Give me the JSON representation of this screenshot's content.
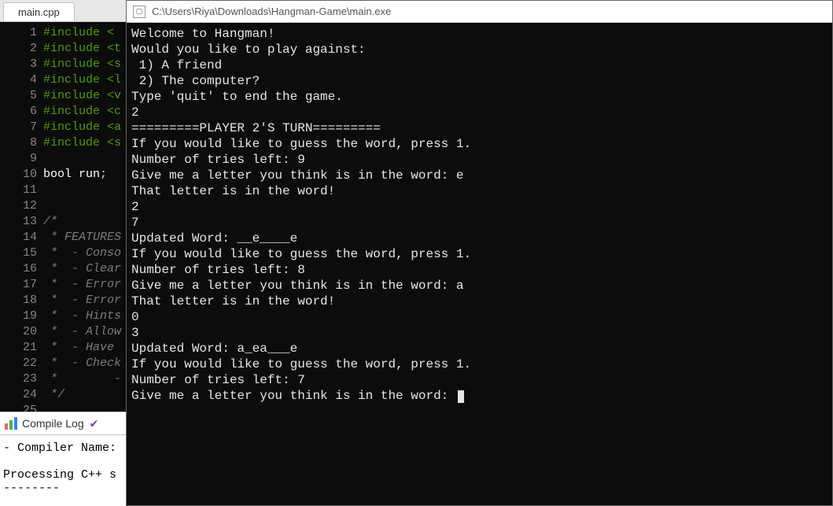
{
  "editor": {
    "tab_label": "main.cpp",
    "lines": [
      {
        "n": "1",
        "cls": "kw-include",
        "t": "#include <"
      },
      {
        "n": "2",
        "cls": "kw-include",
        "t": "#include <t"
      },
      {
        "n": "3",
        "cls": "kw-include",
        "t": "#include <s"
      },
      {
        "n": "4",
        "cls": "kw-include",
        "t": "#include <l"
      },
      {
        "n": "5",
        "cls": "kw-include",
        "t": "#include <v"
      },
      {
        "n": "6",
        "cls": "kw-include",
        "t": "#include <c"
      },
      {
        "n": "7",
        "cls": "kw-include",
        "t": "#include <a"
      },
      {
        "n": "8",
        "cls": "kw-include",
        "t": "#include <s"
      },
      {
        "n": "9",
        "cls": "",
        "t": ""
      },
      {
        "n": "10",
        "cls": "",
        "t": "bool run;"
      },
      {
        "n": "11",
        "cls": "",
        "t": ""
      },
      {
        "n": "12",
        "cls": "",
        "t": ""
      },
      {
        "n": "13",
        "cls": "cmt",
        "t": "/*"
      },
      {
        "n": "14",
        "cls": "cmt",
        "t": " * FEATURES"
      },
      {
        "n": "15",
        "cls": "cmt",
        "t": " *  - Conso"
      },
      {
        "n": "16",
        "cls": "cmt",
        "t": " *  - Clear"
      },
      {
        "n": "17",
        "cls": "cmt",
        "t": " *  - Error"
      },
      {
        "n": "18",
        "cls": "cmt",
        "t": " *  - Error"
      },
      {
        "n": "19",
        "cls": "cmt",
        "t": " *  - Hints"
      },
      {
        "n": "20",
        "cls": "cmt",
        "t": " *  - Allow"
      },
      {
        "n": "21",
        "cls": "cmt",
        "t": " *  - Have "
      },
      {
        "n": "22",
        "cls": "cmt",
        "t": " *  - Check"
      },
      {
        "n": "23",
        "cls": "cmt",
        "t": " *        -"
      },
      {
        "n": "24",
        "cls": "cmt",
        "t": " */"
      },
      {
        "n": "25",
        "cls": "",
        "t": ""
      }
    ],
    "bottom_panel": {
      "tab_label": "Compile Log",
      "body_line1": "- Compiler Name:",
      "body_line2": "",
      "body_line3": "Processing C++ s",
      "body_line4": "--------"
    }
  },
  "console": {
    "title": "C:\\Users\\Riya\\Downloads\\Hangman-Game\\main.exe",
    "lines": [
      "Welcome to Hangman!",
      "Would you like to play against:",
      " 1) A friend",
      " 2) The computer?",
      "Type 'quit' to end the game.",
      "2",
      "=========PLAYER 2'S TURN=========",
      "If you would like to guess the word, press 1.",
      "Number of tries left: 9",
      "Give me a letter you think is in the word: e",
      "That letter is in the word!",
      "2",
      "7",
      "Updated Word: __e____e",
      "If you would like to guess the word, press 1.",
      "Number of tries left: 8",
      "Give me a letter you think is in the word: a",
      "That letter is in the word!",
      "0",
      "3",
      "Updated Word: a_ea___e",
      "If you would like to guess the word, press 1.",
      "Number of tries left: 7",
      "Give me a letter you think is in the word: "
    ]
  }
}
